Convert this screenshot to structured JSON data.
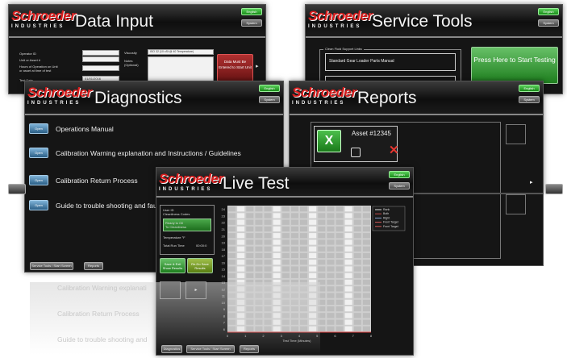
{
  "brand": {
    "name": "Schroeder",
    "sub": "INDUSTRIES"
  },
  "common": {
    "lang_label": "English",
    "sys_label": "System",
    "open_label": "Open"
  },
  "data_input": {
    "title": "Data Input",
    "labels": {
      "operator_id": "Operator ID",
      "unit_asset": "Unit or Asset #",
      "hours": "Hours of Operation on Unit",
      "hours2": "or asset at time of test",
      "test_date": "Test Date",
      "viscosity": "Viscosity",
      "notes": "Notes",
      "notes2": "(Optional)"
    },
    "viscosity_value": "ISO 32 (10 cSt @ 40 Temperature)",
    "date_value": "01/01/2016",
    "start_note": "Data Must Be Entered to Start Unit"
  },
  "service_tools": {
    "title": "Service Tools",
    "group_label": "Clean Fluid Support Links",
    "manual_label": "Standard Gear Loader Parts Manual",
    "press_label": "Press Here to Start Testing"
  },
  "diagnostics": {
    "title": "Diagnostics",
    "items": [
      "Operations Manual",
      "Calibration Warning explanation and Instructions / Guidelines",
      "Calibration Return  Process",
      "Guide to trouble shooting and fau"
    ],
    "footer": [
      "Service Tools / Start Screen",
      "Reports"
    ]
  },
  "reports": {
    "title": "Reports",
    "asset": "Asset #12345",
    "file_icon": "excel-icon"
  },
  "live_test": {
    "title": "Live Test",
    "status_lines": [
      "User ID",
      "Cleanliness Codes"
    ],
    "ready_lines": [
      "Ready to Oil",
      "To Cleanliness"
    ],
    "temperature_label": "Temperature °F",
    "total_run_label": "Total Run Time",
    "total_run_value": "00:00:0",
    "btn_save": "Save & Exit Show Results",
    "btn_retest": "Re-Do Save Results",
    "legend": [
      "Rank",
      "Both",
      "Right",
      "Front Target",
      "Front Target"
    ],
    "x_axis_label": "Test Time (Minutes)",
    "y_ticks": [
      "24",
      "23",
      "22",
      "21",
      "20",
      "19",
      "18",
      "17",
      "16",
      "15",
      "14",
      "13",
      "12",
      "11",
      "10",
      "9",
      "8",
      "7",
      "6"
    ],
    "x_ticks": [
      "0",
      "1",
      "2",
      "3",
      "4",
      "5",
      "6",
      "7",
      "8"
    ],
    "footer": [
      "Diagnostics",
      "Service Tools / Start Screen",
      "Reports"
    ]
  },
  "reflection": {
    "items": [
      "Calibration Warning explanati",
      "Calibration Return  Process",
      "Guide to trouble shooting and"
    ]
  }
}
